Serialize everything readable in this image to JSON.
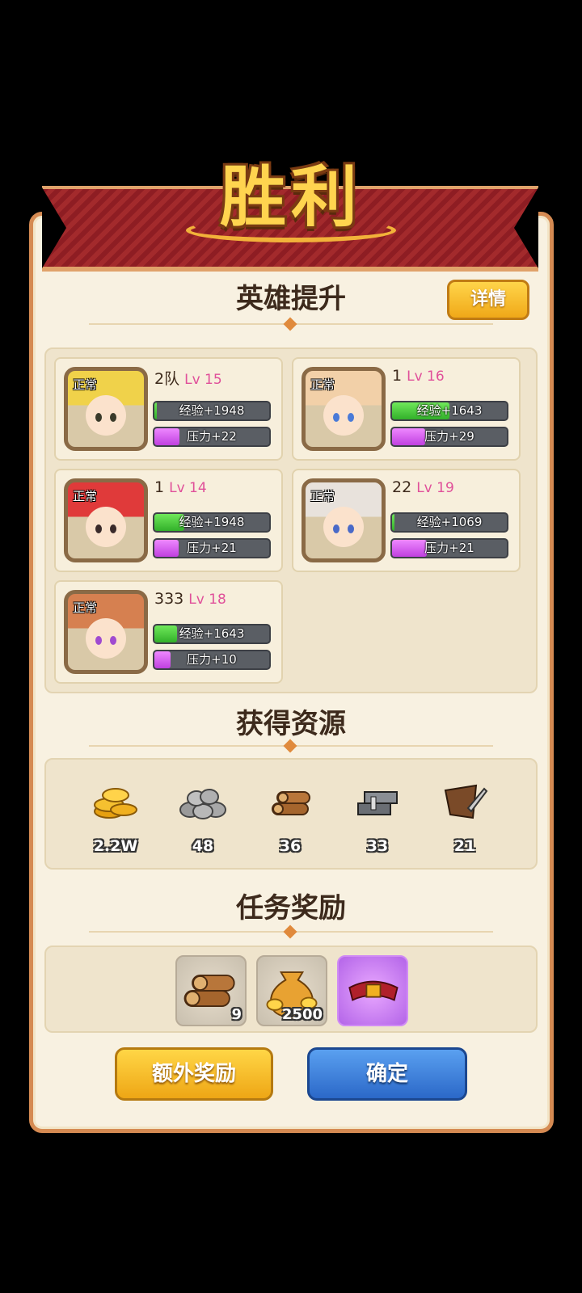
{
  "header": {
    "title": "胜利"
  },
  "hero_section": {
    "title": "英雄提升",
    "detail_label": "详情",
    "heroes": [
      {
        "name": "2队",
        "level": "Lv 15",
        "status": "正常",
        "exp_label": "经验+1948",
        "exp_fill": 0.02,
        "stress_label": "压力+22",
        "stress_fill": 0.22,
        "hair": "#f0d24a",
        "eye": "#3a3a2a"
      },
      {
        "name": "1",
        "level": "Lv 16",
        "status": "正常",
        "exp_label": "经验+1643",
        "exp_fill": 0.5,
        "stress_label": "压力+29",
        "stress_fill": 0.29,
        "hair": "#f2d0a8",
        "eye": "#4a7ad8"
      },
      {
        "name": "1",
        "level": "Lv 14",
        "status": "正常",
        "exp_label": "经验+1948",
        "exp_fill": 0.26,
        "stress_label": "压力+21",
        "stress_fill": 0.21,
        "hair": "#e03a3a",
        "eye": "#3a2a2a"
      },
      {
        "name": "22",
        "level": "Lv 19",
        "status": "正常",
        "exp_label": "经验+1069",
        "exp_fill": 0.02,
        "stress_label": "压力+21",
        "stress_fill": 0.3,
        "hair": "#e8e2dc",
        "eye": "#4a6ac8"
      },
      {
        "name": "333",
        "level": "Lv 18",
        "status": "正常",
        "exp_label": "经验+1643",
        "exp_fill": 0.2,
        "stress_label": "压力+10",
        "stress_fill": 0.14,
        "hair": "#d68050",
        "eye": "#a04ad0"
      }
    ]
  },
  "resource_section": {
    "title": "获得资源",
    "items": [
      {
        "icon": "gold-coins-icon",
        "value": "2.2W"
      },
      {
        "icon": "stone-icon",
        "value": "48"
      },
      {
        "icon": "wood-icon",
        "value": "36"
      },
      {
        "icon": "iron-icon",
        "value": "33"
      },
      {
        "icon": "leather-icon",
        "value": "21"
      }
    ]
  },
  "reward_section": {
    "title": "任务奖励",
    "items": [
      {
        "icon": "wood-icon",
        "count": "9"
      },
      {
        "icon": "money-bag-icon",
        "count": "2500"
      },
      {
        "icon": "red-belt-icon",
        "count": ""
      }
    ]
  },
  "buttons": {
    "extra": "额外奖励",
    "confirm": "确定"
  }
}
